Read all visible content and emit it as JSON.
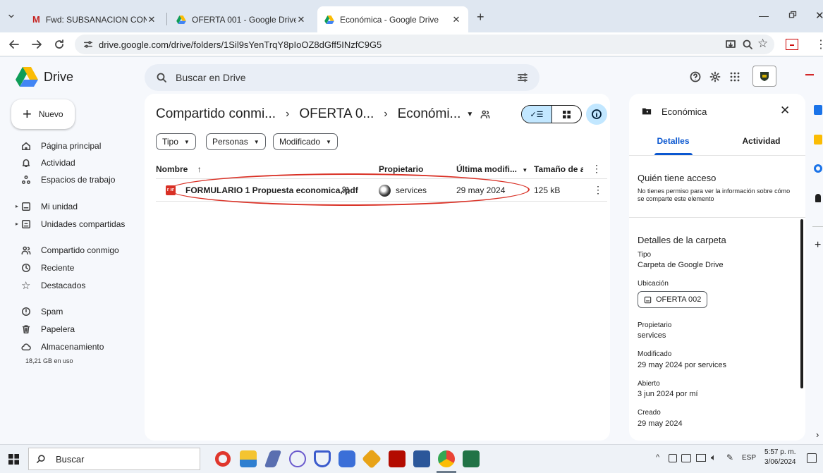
{
  "browser": {
    "tabs": [
      {
        "title": "Fwd: SUBSANACION CONVOCA"
      },
      {
        "title": "OFERTA 001 - Google Drive"
      },
      {
        "title": "Económica - Google Drive"
      }
    ],
    "url": "drive.google.com/drive/folders/1Sil9sYenTrqY8pIoOZ8dGff5INzfC9G5"
  },
  "app": {
    "name": "Drive",
    "search_placeholder": "Buscar en Drive",
    "new_button": "Nuevo"
  },
  "sidebar": {
    "items": [
      {
        "label": "Página principal",
        "icon": "home-icon"
      },
      {
        "label": "Actividad",
        "icon": "bell-icon"
      },
      {
        "label": "Espacios de trabajo",
        "icon": "workspaces-icon"
      },
      {
        "label": "Mi unidad",
        "icon": "drive-icon"
      },
      {
        "label": "Unidades compartidas",
        "icon": "shared-drives-icon"
      },
      {
        "label": "Compartido conmigo",
        "icon": "people-icon"
      },
      {
        "label": "Reciente",
        "icon": "clock-icon"
      },
      {
        "label": "Destacados",
        "icon": "star-icon"
      },
      {
        "label": "Spam",
        "icon": "spam-icon"
      },
      {
        "label": "Papelera",
        "icon": "trash-icon"
      },
      {
        "label": "Almacenamiento",
        "icon": "cloud-icon"
      }
    ],
    "storage_used": "18,21 GB en uso"
  },
  "breadcrumb": [
    "Compartido conmi...",
    "OFERTA 0...",
    "Económi..."
  ],
  "filters": [
    "Tipo",
    "Personas",
    "Modificado"
  ],
  "table": {
    "headers": {
      "name": "Nombre",
      "owner": "Propietario",
      "modified": "Última modifi...",
      "size": "Tamaño de a"
    },
    "rows": [
      {
        "name": "FORMULARIO 1 Propuesta economica..pdf",
        "owner": "services",
        "modified": "29 may 2024",
        "size": "125 kB"
      }
    ]
  },
  "details": {
    "title": "Económica",
    "tabs": [
      "Detalles",
      "Actividad"
    ],
    "access_heading": "Quién tiene acceso",
    "access_text": "No tienes permiso para ver la información sobre cómo se comparte este elemento",
    "folder_heading": "Detalles de la carpeta",
    "type_label": "Tipo",
    "type_value": "Carpeta de Google Drive",
    "location_label": "Ubicación",
    "location_value": "OFERTA 002",
    "owner_label": "Propietario",
    "owner_value": "services",
    "modified_label": "Modificado",
    "modified_value": "29 may 2024 por services",
    "opened_label": "Abierto",
    "opened_value": "3 jun 2024 por mí",
    "created_label": "Creado",
    "created_value": "29 may 2024"
  },
  "taskbar": {
    "search": "Buscar",
    "lang": "ESP",
    "time": "5:57 p. m.",
    "date": "3/06/2024"
  },
  "colors": {
    "accent": "#0b57d0",
    "selected_bg": "#c2e7ff",
    "highlight": "#d93025"
  }
}
